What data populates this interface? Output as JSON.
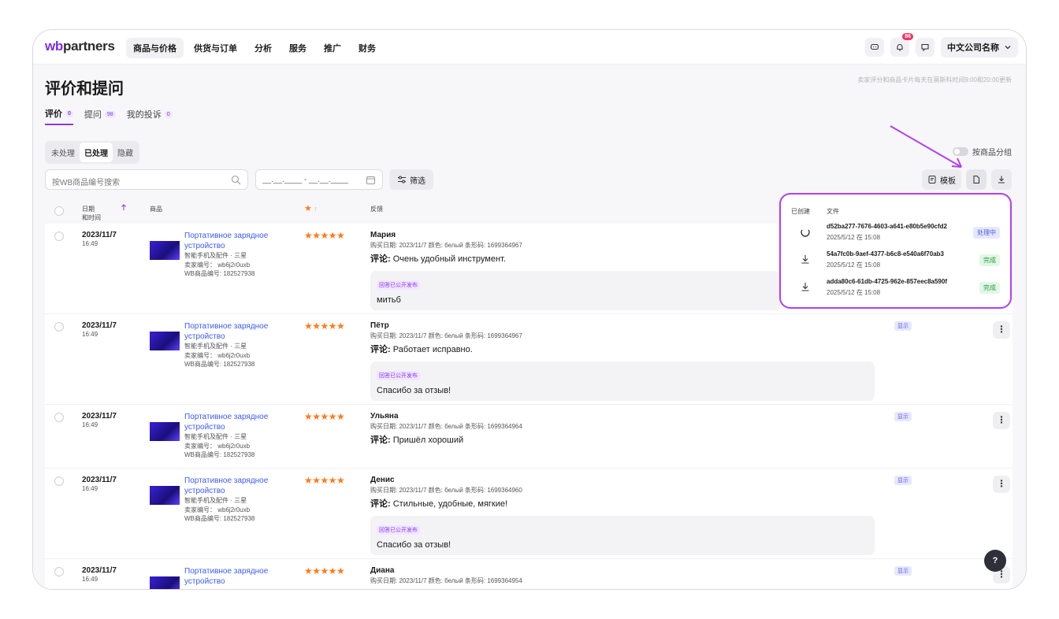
{
  "logo": "wbpartners",
  "nav": [
    "商品与价格",
    "供货与订单",
    "分析",
    "服务",
    "推广",
    "财务"
  ],
  "header": {
    "notification_count": "86",
    "company_name": "中文公司名称"
  },
  "page": {
    "title": "评价和提问",
    "update_note": "卖家评分和商品卡片每天在莫斯科时间9:00和20:00更新"
  },
  "tabs": [
    {
      "label": "评价",
      "count": "0"
    },
    {
      "label": "提问",
      "count": "98"
    },
    {
      "label": "我的投诉",
      "count": "0"
    }
  ],
  "segments": [
    "未处理",
    "已处理",
    "隐藏"
  ],
  "group_toggle_label": "按商品分组",
  "search": {
    "placeholder": "按WB商品编号搜索"
  },
  "date_range": "__.__.____ - __.__.____",
  "filter_label": "筛选",
  "template_label": "模板",
  "table": {
    "headers": {
      "date": "日期",
      "time": "和时间",
      "product": "商品",
      "feedback": "反馈"
    },
    "rows": [
      {
        "date": "2023/11/7",
        "time": "16:49",
        "product_name": "Портативное зарядное устройство",
        "category": "智能手机及配件 · 三星",
        "seller_code": "卖家编号： wb6j2r0uxb",
        "wb_code": "WB商品编号: 182527938",
        "stars": "★★★★★",
        "author": "Мария",
        "meta": "购买日期: 2023/11/7   颜色: белый   条形码: 1699364967",
        "comment_label": "评论:",
        "comment": "Очень удобный инструмент.",
        "reply_tag": "回答已公开发布",
        "reply": "митьб",
        "status": ""
      },
      {
        "date": "2023/11/7",
        "time": "16:49",
        "product_name": "Портативное зарядное устройство",
        "category": "智能手机及配件 · 三星",
        "seller_code": "卖家编号： wb6j2r0uxb",
        "wb_code": "WB商品编号: 182527938",
        "stars": "★★★★★",
        "author": "Пётр",
        "meta": "购买日期: 2023/11/7   颜色: белый   条形码: 1699364967",
        "comment_label": "评论:",
        "comment": "Работает исправно.",
        "reply_tag": "回答已公开发布",
        "reply": "Спасибо за отзыв!",
        "status": "显示"
      },
      {
        "date": "2023/11/7",
        "time": "16:49",
        "product_name": "Портативное зарядное устройство",
        "category": "智能手机及配件 · 三星",
        "seller_code": "卖家编号： wb6j2r0uxb",
        "wb_code": "WB商品编号: 182527938",
        "stars": "★★★★★",
        "author": "Ульяна",
        "meta": "购买日期: 2023/11/7   颜色: белый   条形码: 1699364964",
        "comment_label": "评论:",
        "comment": "Пришёл хороший",
        "reply_tag": "",
        "reply": "",
        "status": "显示"
      },
      {
        "date": "2023/11/7",
        "time": "16:49",
        "product_name": "Портативное зарядное устройство",
        "category": "智能手机及配件 · 三星",
        "seller_code": "卖家编号： wb6j2r0uxb",
        "wb_code": "WB商品编号: 182527938",
        "stars": "★★★★★",
        "author": "Денис",
        "meta": "购买日期: 2023/11/7   颜色: белый   条形码: 1699364960",
        "comment_label": "评论:",
        "comment": "Стильные, удобные, мягкие!",
        "reply_tag": "回答已公开发布",
        "reply": "Спасибо за отзыв!",
        "status": "显示"
      },
      {
        "date": "2023/11/7",
        "time": "16:49",
        "product_name": "Портативное зарядное устройство",
        "category": "",
        "seller_code": "",
        "wb_code": "",
        "stars": "★★★★★",
        "author": "Диана",
        "meta": "购买日期: 2023/11/7   颜色: белый   条形码: 1699364954",
        "comment_label": "",
        "comment": "",
        "reply_tag": "",
        "reply": "",
        "status": "显示"
      }
    ]
  },
  "export_popover": {
    "col_created": "已创建",
    "col_file": "文件",
    "files": [
      {
        "name": "d52ba277-7676-4603-a641-e80b5e90cfd2",
        "date": "2025/5/12 在 15:08",
        "status": "处理中"
      },
      {
        "name": "54a7fc0b-9aef-4377-b6c8-e540a6f70ab3",
        "date": "2025/5/12 在 15:08",
        "status": "完成"
      },
      {
        "name": "adda80c6-61db-4725-962e-857eec8a590f",
        "date": "2025/5/12 在 15:08",
        "status": "完成"
      }
    ]
  },
  "help_label": "?",
  "colors": {
    "accent": "#8c35f5",
    "link": "#3d5bf5",
    "star": "#ff7a1a",
    "annotation": "#b33df5"
  }
}
